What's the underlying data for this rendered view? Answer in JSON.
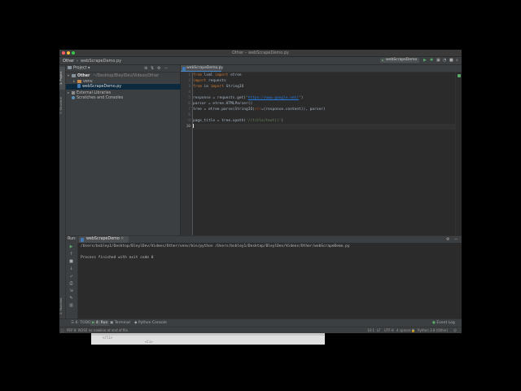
{
  "window": {
    "title": "Other – webScrapeDemo.py"
  },
  "navbar": {
    "breadcrumb_project": "Other",
    "breadcrumb_file": "webScrapeDemo.py",
    "run_config": "webScrapeDemo"
  },
  "left_strip": {
    "project_tab": "1: Project",
    "structure_tab": "7: Structure",
    "favorites_tab": "2: Favorites"
  },
  "project_panel": {
    "header": "Project",
    "tree": [
      {
        "label": "Other",
        "path": "~/Desktop/BleylDev/Videos/Other",
        "indent": 0,
        "arrow": "▾",
        "icon": "folder"
      },
      {
        "label": "venv",
        "indent": 1,
        "arrow": "▸",
        "icon": "folder-orange"
      },
      {
        "label": "webScrapeDemo.py",
        "indent": 1,
        "arrow": "",
        "icon": "python"
      },
      {
        "label": "External Libraries",
        "indent": 0,
        "arrow": "▸",
        "icon": "library"
      },
      {
        "label": "Scratches and Consoles",
        "indent": 0,
        "arrow": "",
        "icon": "scratch"
      }
    ]
  },
  "editor": {
    "tab_label": "webScrapeDemo.py",
    "line_numbers": [
      "1",
      "2",
      "3",
      "4",
      "5",
      "6",
      "7",
      "8",
      "9",
      "10"
    ],
    "code": {
      "l1": {
        "kw1": "from",
        "mod": " lxml ",
        "kw2": "import",
        "name": " etree"
      },
      "l2": {
        "kw": "import",
        "name": " requests"
      },
      "l3": {
        "kw1": "from",
        "mod": " io ",
        "kw2": "import",
        "name": " StringIO"
      },
      "l5": {
        "pre": "response = requests.get(",
        "q1": "\"",
        "url": "https://www.google.net/",
        "q2": "\"",
        "post": ")"
      },
      "l6": {
        "text": "parser = etree.HTMLParser()"
      },
      "l7": {
        "pre": "tree = etree.parse(StringIO(",
        "param": "str",
        "post": "=(response.content)), parser)"
      },
      "l9": {
        "pre": "page_title = tree.xpath(",
        "str": "'//title/text()'",
        "post": ")"
      }
    }
  },
  "run_panel": {
    "label": "Run:",
    "tab": "webScrapeDemo",
    "command": "/Users/bsbley1/Desktop/BleylDev/Videos/Other/venv/bin/python /Users/bsbley1/Desktop/BleylDev/Videos/Other/webScrapeDemo.py",
    "exit_message": "Process finished with exit code 0"
  },
  "bottom_tabs": {
    "todo": "6: TODO",
    "run": "4: Run",
    "terminal": "Terminal",
    "console": "Python Console",
    "event_log": "Event Log"
  },
  "status_bar": {
    "message": "PEP 8: W292 no newline at end of file",
    "position": "10:1",
    "line_sep": "LF",
    "encoding": "UTF-8",
    "indent": "4 spaces",
    "interpreter": "Python 3.8 (Other)"
  },
  "colors": {
    "accent": "#4a88c7",
    "keyword": "#cc7832",
    "string": "#6a8759",
    "run_green": "#59a869"
  }
}
